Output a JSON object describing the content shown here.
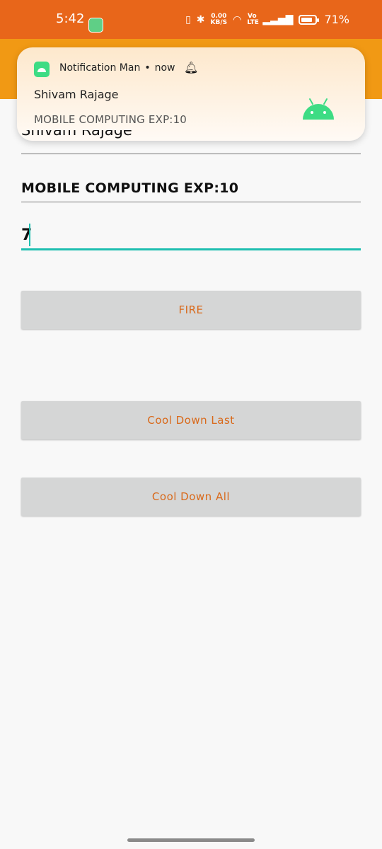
{
  "status_bar": {
    "time": "5:42",
    "net_speed_value": "0.00",
    "net_speed_unit": "KB/S",
    "volte": "Vo LTE",
    "battery": "71%",
    "bar_color": "#e8661a"
  },
  "app_bar": {
    "color": "#f19914"
  },
  "notification": {
    "app_name": "Notification Man",
    "time": "now",
    "title": "Shivam Rajage",
    "text": "MOBILE COMPUTING EXP:10",
    "accent": "#3ddc84"
  },
  "form": {
    "name_field": "Shivam Rajage",
    "subject_field": "MOBILE COMPUTING EXP:10",
    "number_input": "7",
    "accent": "#1ebfb0"
  },
  "buttons": {
    "fire": "FIRE",
    "cool_down_last": "Cool Down Last",
    "cool_down_all": "Cool Down All",
    "text_color": "#d9691a"
  }
}
